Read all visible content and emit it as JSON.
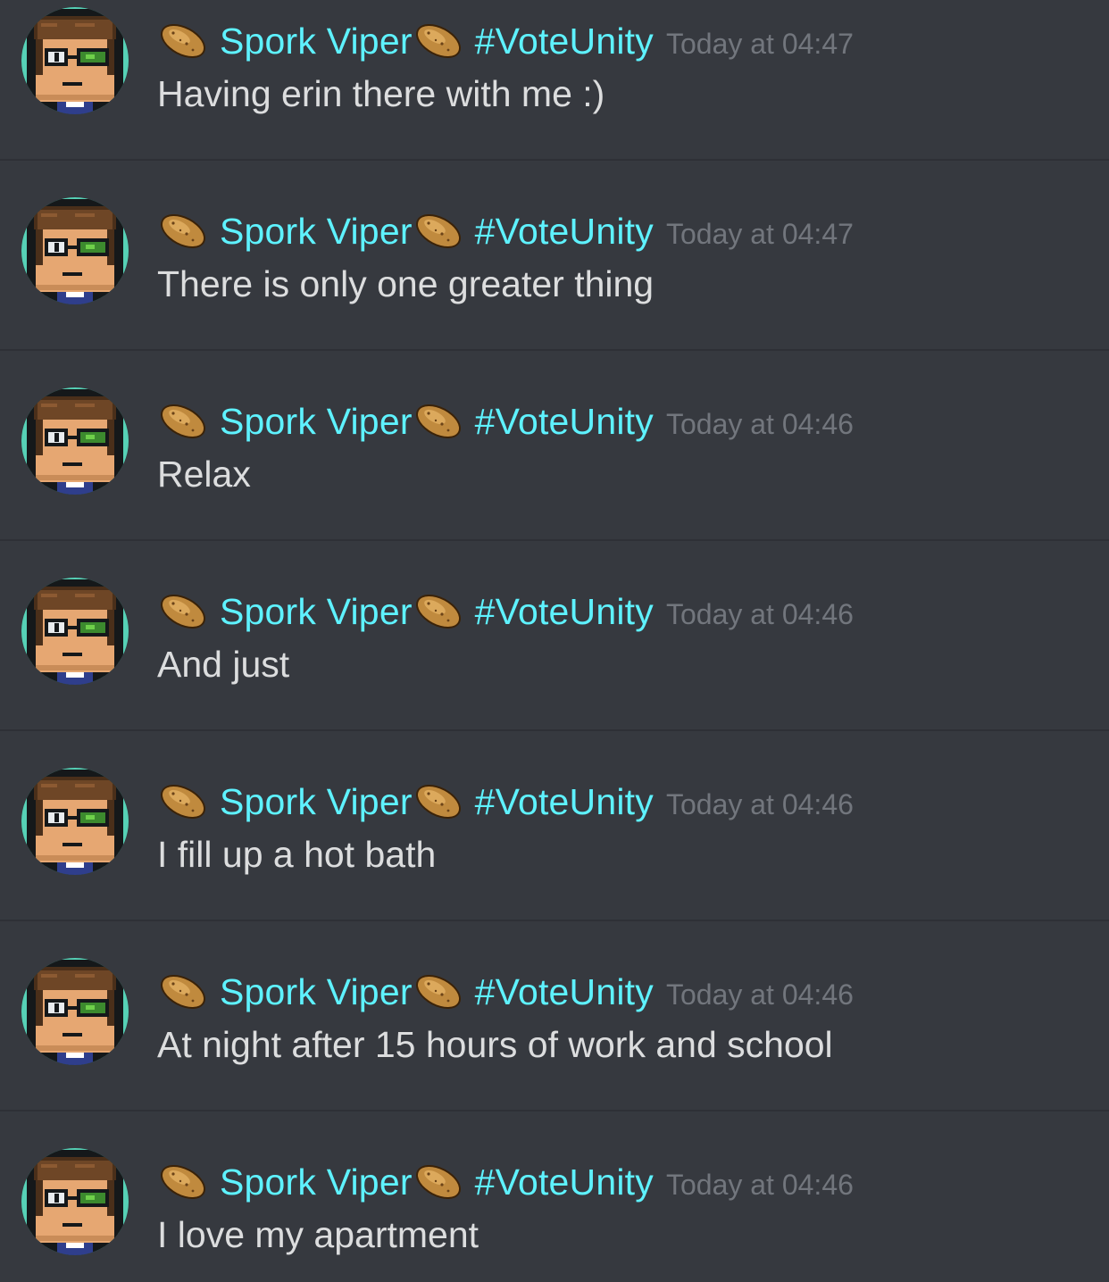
{
  "colors": {
    "background": "#36393f",
    "username": "#5ef2ff",
    "timestamp": "#72767d",
    "text": "#dcddde",
    "divider": "#2e3036"
  },
  "messages": [
    {
      "user_name": "Spork Viper",
      "user_tag": "#VoteUnity",
      "timestamp": "Today at 04:47",
      "text": "Having erin there with me :)",
      "avatar_icon": "pixel-avatar-icon",
      "name_icon": "potato-icon"
    },
    {
      "user_name": "Spork Viper",
      "user_tag": "#VoteUnity",
      "timestamp": "Today at 04:47",
      "text": "There is only one greater thing",
      "avatar_icon": "pixel-avatar-icon",
      "name_icon": "potato-icon"
    },
    {
      "user_name": "Spork Viper",
      "user_tag": "#VoteUnity",
      "timestamp": "Today at 04:46",
      "text": "Relax",
      "avatar_icon": "pixel-avatar-icon",
      "name_icon": "potato-icon"
    },
    {
      "user_name": "Spork Viper",
      "user_tag": "#VoteUnity",
      "timestamp": "Today at 04:46",
      "text": "And just",
      "avatar_icon": "pixel-avatar-icon",
      "name_icon": "potato-icon"
    },
    {
      "user_name": "Spork Viper",
      "user_tag": "#VoteUnity",
      "timestamp": "Today at 04:46",
      "text": "I fill up a hot bath",
      "avatar_icon": "pixel-avatar-icon",
      "name_icon": "potato-icon"
    },
    {
      "user_name": "Spork Viper",
      "user_tag": "#VoteUnity",
      "timestamp": "Today at 04:46",
      "text": "At night after 15 hours of work and school",
      "avatar_icon": "pixel-avatar-icon",
      "name_icon": "potato-icon"
    },
    {
      "user_name": "Spork Viper",
      "user_tag": "#VoteUnity",
      "timestamp": "Today at 04:46",
      "text": "I love my apartment",
      "avatar_icon": "pixel-avatar-icon",
      "name_icon": "potato-icon"
    }
  ]
}
